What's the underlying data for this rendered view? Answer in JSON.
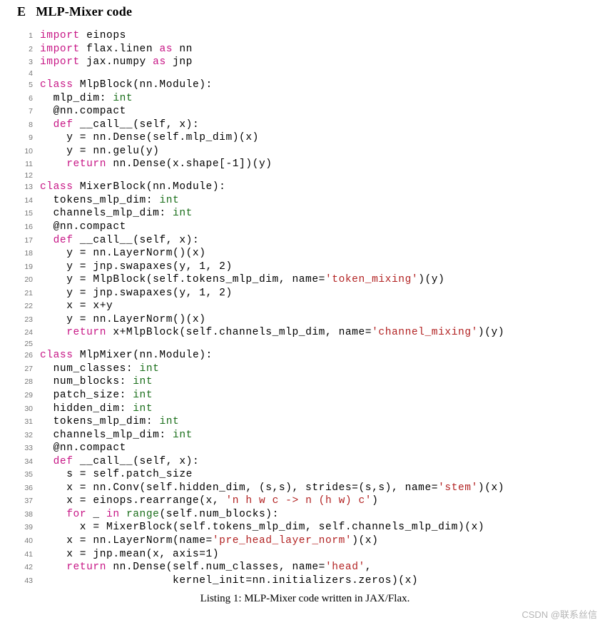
{
  "heading": {
    "section_letter": "E",
    "title": "MLP-Mixer code"
  },
  "caption": "Listing 1: MLP-Mixer code written in JAX/Flax.",
  "watermark": "CSDN @联系丝信",
  "code_lines": [
    {
      "n": 1,
      "tokens": [
        [
          "kw",
          "import"
        ],
        [
          "",
          " einops"
        ]
      ]
    },
    {
      "n": 2,
      "tokens": [
        [
          "kw",
          "import"
        ],
        [
          "",
          " flax.linen "
        ],
        [
          "kw",
          "as"
        ],
        [
          "",
          " nn"
        ]
      ]
    },
    {
      "n": 3,
      "tokens": [
        [
          "kw",
          "import"
        ],
        [
          "",
          " jax.numpy "
        ],
        [
          "kw",
          "as"
        ],
        [
          "",
          " jnp"
        ]
      ]
    },
    {
      "n": 4,
      "tokens": [
        [
          "",
          ""
        ]
      ]
    },
    {
      "n": 5,
      "tokens": [
        [
          "kw",
          "class"
        ],
        [
          "",
          " MlpBlock(nn.Module):"
        ]
      ]
    },
    {
      "n": 6,
      "tokens": [
        [
          "",
          "  mlp_dim: "
        ],
        [
          "tp",
          "int"
        ]
      ]
    },
    {
      "n": 7,
      "tokens": [
        [
          "",
          "  @nn.compact"
        ]
      ]
    },
    {
      "n": 8,
      "tokens": [
        [
          "",
          "  "
        ],
        [
          "kw",
          "def"
        ],
        [
          "",
          " __call__(self, x):"
        ]
      ]
    },
    {
      "n": 9,
      "tokens": [
        [
          "",
          "    y = nn.Dense(self.mlp_dim)(x)"
        ]
      ]
    },
    {
      "n": 10,
      "tokens": [
        [
          "",
          "    y = nn.gelu(y)"
        ]
      ]
    },
    {
      "n": 11,
      "tokens": [
        [
          "",
          "    "
        ],
        [
          "kw",
          "return"
        ],
        [
          "",
          " nn.Dense(x.shape[-1])(y)"
        ]
      ]
    },
    {
      "n": 12,
      "tokens": [
        [
          "",
          ""
        ]
      ]
    },
    {
      "n": 13,
      "tokens": [
        [
          "kw",
          "class"
        ],
        [
          "",
          " MixerBlock(nn.Module):"
        ]
      ]
    },
    {
      "n": 14,
      "tokens": [
        [
          "",
          "  tokens_mlp_dim: "
        ],
        [
          "tp",
          "int"
        ]
      ]
    },
    {
      "n": 15,
      "tokens": [
        [
          "",
          "  channels_mlp_dim: "
        ],
        [
          "tp",
          "int"
        ]
      ]
    },
    {
      "n": 16,
      "tokens": [
        [
          "",
          "  @nn.compact"
        ]
      ]
    },
    {
      "n": 17,
      "tokens": [
        [
          "",
          "  "
        ],
        [
          "kw",
          "def"
        ],
        [
          "",
          " __call__(self, x):"
        ]
      ]
    },
    {
      "n": 18,
      "tokens": [
        [
          "",
          "    y = nn.LayerNorm()(x)"
        ]
      ]
    },
    {
      "n": 19,
      "tokens": [
        [
          "",
          "    y = jnp.swapaxes(y, 1, 2)"
        ]
      ]
    },
    {
      "n": 20,
      "tokens": [
        [
          "",
          "    y = MlpBlock(self.tokens_mlp_dim, name="
        ],
        [
          "str",
          "'token_mixing'"
        ],
        [
          "",
          ")(y)"
        ]
      ]
    },
    {
      "n": 21,
      "tokens": [
        [
          "",
          "    y = jnp.swapaxes(y, 1, 2)"
        ]
      ]
    },
    {
      "n": 22,
      "tokens": [
        [
          "",
          "    x = x+y"
        ]
      ]
    },
    {
      "n": 23,
      "tokens": [
        [
          "",
          "    y = nn.LayerNorm()(x)"
        ]
      ]
    },
    {
      "n": 24,
      "tokens": [
        [
          "",
          "    "
        ],
        [
          "kw",
          "return"
        ],
        [
          "",
          " x+MlpBlock(self.channels_mlp_dim, name="
        ],
        [
          "str",
          "'channel_mixing'"
        ],
        [
          "",
          ")(y)"
        ]
      ]
    },
    {
      "n": 25,
      "tokens": [
        [
          "",
          ""
        ]
      ]
    },
    {
      "n": 26,
      "tokens": [
        [
          "kw",
          "class"
        ],
        [
          "",
          " MlpMixer(nn.Module):"
        ]
      ]
    },
    {
      "n": 27,
      "tokens": [
        [
          "",
          "  num_classes: "
        ],
        [
          "tp",
          "int"
        ]
      ]
    },
    {
      "n": 28,
      "tokens": [
        [
          "",
          "  num_blocks: "
        ],
        [
          "tp",
          "int"
        ]
      ]
    },
    {
      "n": 29,
      "tokens": [
        [
          "",
          "  patch_size: "
        ],
        [
          "tp",
          "int"
        ]
      ]
    },
    {
      "n": 30,
      "tokens": [
        [
          "",
          "  hidden_dim: "
        ],
        [
          "tp",
          "int"
        ]
      ]
    },
    {
      "n": 31,
      "tokens": [
        [
          "",
          "  tokens_mlp_dim: "
        ],
        [
          "tp",
          "int"
        ]
      ]
    },
    {
      "n": 32,
      "tokens": [
        [
          "",
          "  channels_mlp_dim: "
        ],
        [
          "tp",
          "int"
        ]
      ]
    },
    {
      "n": 33,
      "tokens": [
        [
          "",
          "  @nn.compact"
        ]
      ]
    },
    {
      "n": 34,
      "tokens": [
        [
          "",
          "  "
        ],
        [
          "kw",
          "def"
        ],
        [
          "",
          " __call__(self, x):"
        ]
      ]
    },
    {
      "n": 35,
      "tokens": [
        [
          "",
          "    s = self.patch_size"
        ]
      ]
    },
    {
      "n": 36,
      "tokens": [
        [
          "",
          "    x = nn.Conv(self.hidden_dim, (s,s), strides=(s,s), name="
        ],
        [
          "str",
          "'stem'"
        ],
        [
          "",
          ")(x)"
        ]
      ]
    },
    {
      "n": 37,
      "tokens": [
        [
          "",
          "    x = einops.rearrange(x, "
        ],
        [
          "str",
          "'n h w c -> n (h w) c'"
        ],
        [
          "",
          ")"
        ]
      ]
    },
    {
      "n": 38,
      "tokens": [
        [
          "",
          "    "
        ],
        [
          "kw",
          "for"
        ],
        [
          "",
          " _ "
        ],
        [
          "kw",
          "in"
        ],
        [
          "",
          " "
        ],
        [
          "tp",
          "range"
        ],
        [
          "",
          "(self.num_blocks):"
        ]
      ]
    },
    {
      "n": 39,
      "tokens": [
        [
          "",
          "      x = MixerBlock(self.tokens_mlp_dim, self.channels_mlp_dim)(x)"
        ]
      ]
    },
    {
      "n": 40,
      "tokens": [
        [
          "",
          "    x = nn.LayerNorm(name="
        ],
        [
          "str",
          "'pre_head_layer_norm'"
        ],
        [
          "",
          ")(x)"
        ]
      ]
    },
    {
      "n": 41,
      "tokens": [
        [
          "",
          "    x = jnp.mean(x, axis=1)"
        ]
      ]
    },
    {
      "n": 42,
      "tokens": [
        [
          "",
          "    "
        ],
        [
          "kw",
          "return"
        ],
        [
          "",
          " nn.Dense(self.num_classes, name="
        ],
        [
          "str",
          "'head'"
        ],
        [
          "",
          ","
        ]
      ]
    },
    {
      "n": 43,
      "tokens": [
        [
          "",
          "                    kernel_init=nn.initializers.zeros)(x)"
        ]
      ]
    }
  ]
}
